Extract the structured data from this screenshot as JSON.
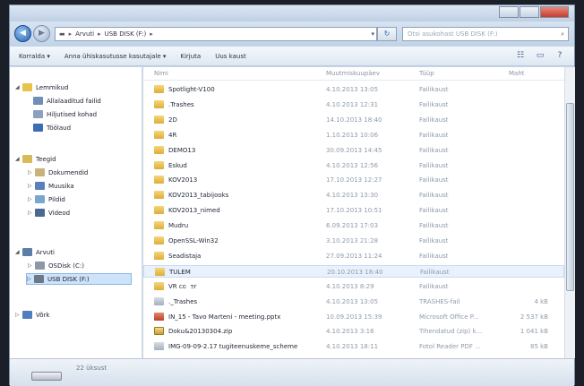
{
  "window": {
    "title_buttons": [
      "minimize",
      "maximize",
      "close"
    ],
    "colors": {
      "accent": "#2b63b8",
      "close": "#c43c2a"
    }
  },
  "address": {
    "crumbs": [
      "Arvuti",
      "USB DISK (F:)"
    ],
    "search_placeholder": "Otsi asukohast USB DISK (F:)"
  },
  "toolbar": {
    "organize": "Korralda ▾",
    "share": "Anna ühiskasutusse kasutajale ▾",
    "burn": "Kirjuta",
    "new_folder": "Uus kaust"
  },
  "nav": {
    "favorites": {
      "label": "Lemmikud",
      "items": [
        "Allalaaditud failid",
        "Hiljutised kohad",
        "Töölaud"
      ]
    },
    "libraries": {
      "label": "Teegid",
      "items": [
        "Dokumendid",
        "Muusika",
        "Pildid",
        "Videod"
      ]
    },
    "computer": {
      "label": "Arvuti",
      "items": [
        "OSDisk (C:)",
        "USB DISK (F:)"
      ]
    },
    "network": {
      "label": "Võrk"
    }
  },
  "columns": {
    "name": "Nimi",
    "date": "Muutmiskuupäev",
    "type": "Tüüp",
    "size": "Maht"
  },
  "files": [
    {
      "name": "Spotlight-V100",
      "date": "4.10.2013 13:05",
      "type": "Failikaust",
      "size": "",
      "icon": "folder"
    },
    {
      "name": ".Trashes",
      "date": "4.10.2013 12:31",
      "type": "Failikaust",
      "size": "",
      "icon": "folder"
    },
    {
      "name": "2D",
      "date": "14.10.2013 18:40",
      "type": "Failikaust",
      "size": "",
      "icon": "folder"
    },
    {
      "name": "4R",
      "date": "1.10.2013 10:06",
      "type": "Failikaust",
      "size": "",
      "icon": "folder"
    },
    {
      "name": "DEMO13",
      "date": "30.09.2013 14:45",
      "type": "Failikaust",
      "size": "",
      "icon": "folder"
    },
    {
      "name": "Eskud",
      "date": "4.10.2013 12:56",
      "type": "Failikaust",
      "size": "",
      "icon": "folder"
    },
    {
      "name": "KOV2013",
      "date": "17.10.2013 12:27",
      "type": "Failikaust",
      "size": "",
      "icon": "folder"
    },
    {
      "name": "KOV2013_tabijooks",
      "date": "4.10.2013 13:30",
      "type": "Failikaust",
      "size": "",
      "icon": "folder"
    },
    {
      "name": "KOV2013_nimed",
      "date": "17.10.2013 10:51",
      "type": "Failikaust",
      "size": "",
      "icon": "folder"
    },
    {
      "name": "Mudru",
      "date": "6.09.2013 17:03",
      "type": "Failikaust",
      "size": "",
      "icon": "folder"
    },
    {
      "name": "OpenSSL-Win32",
      "date": "3.10.2013 21:28",
      "type": "Failikaust",
      "size": "",
      "icon": "folder"
    },
    {
      "name": "Seadistaja",
      "date": "27.09.2013 11:24",
      "type": "Failikaust",
      "size": "",
      "icon": "folder"
    },
    {
      "name": "TULEM",
      "date": "20.10.2013 18:40",
      "type": "Failikaust",
      "size": "",
      "icon": "folder"
    },
    {
      "name": "VR cover",
      "date": "4.10.2013 8:29",
      "type": "Failikaust",
      "size": "",
      "icon": "folder"
    },
    {
      "name": "._Trashes",
      "date": "4.10.2013 13:05",
      "type": "TRASHES-fail",
      "size": "4 kB",
      "icon": "pdf"
    },
    {
      "name": "IN_15 - Tavo Marteni - meeting.pptx",
      "date": "10.09.2013 15:39",
      "type": "Microsoft Office P...",
      "size": "2 537 kB",
      "icon": "doc"
    },
    {
      "name": "Doku&20130304.zip",
      "date": "4.10.2013 3:16",
      "type": "Tihendatud (zip) k...",
      "size": "1 041 kB",
      "icon": "zip"
    },
    {
      "name": "IMG-09-09-2.17 tugiteenuskeme_scheme",
      "date": "4.10.2013 18:11",
      "type": "Fotol Reader PDF ...",
      "size": "85 kB",
      "icon": "pdf"
    }
  ],
  "status": {
    "count": "22 üksust"
  }
}
